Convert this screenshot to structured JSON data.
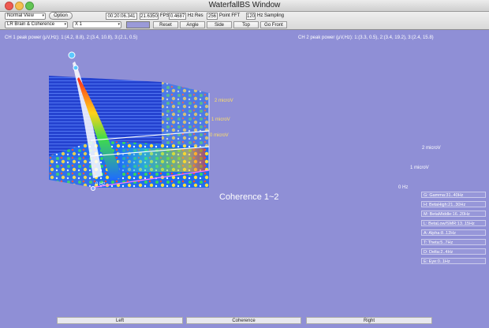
{
  "window": {
    "title": "WaterfallBS Window"
  },
  "toolbar": {
    "view_select": "Normal View",
    "option_button": "Option",
    "mode_select": "LR Brain & Coherence",
    "scale_select": "X 1",
    "time_value": "00:20:06.341",
    "fps_value": "21.6350",
    "fps_label": "FPS",
    "hz_res_value": "0.4687",
    "hz_res_label": "Hz Res",
    "fft_value": "256",
    "fft_label": "Point FFT",
    "sampling_value": "120",
    "sampling_label": "Hz Sampling",
    "reset_button": "Reset",
    "angle_button": "Angle",
    "side_button": "Side",
    "top_button": "Top",
    "go_front_button": "Go Front",
    "swatch_color": "#9a9ad8"
  },
  "left_plot": {
    "title": "CH 1 peak power (μV,Hz): 1:(4.2, 8.8), 2:(3.4, 10.8), 3:(2.1, 0.5)",
    "y_labels": [
      "2 microV",
      "1 microV",
      "0 microV"
    ],
    "axis_label": "0 Hz"
  },
  "right_plot": {
    "title": "CH 2 peak power (μV,Hz): 1:(3.3, 0.5), 2:(3.4, 19.2), 3:(2.4, 15.8)",
    "y_labels": [
      "2 microV",
      "1 microV"
    ],
    "axis_label": "0 Hz"
  },
  "coherence": {
    "label": "Coherence 1~2"
  },
  "band_legend": [
    "G: Gamma:31..40Hz",
    "H: BetaHigh:21..30Hz",
    "M: BetaMiddle:16..20Hz",
    "L: BetaLow/SMR:13..15Hz",
    "A: Alpha:8..12Hz",
    "T: Theta:5..7Hz",
    "D: Delta:2..4Hz",
    "E: Eye:0..1Hz"
  ],
  "bottom_labels": {
    "left": "Left",
    "center": "Coherence",
    "right": "Right"
  },
  "colors": {
    "background": "#8f8fd6",
    "platform": "#1f3fd0",
    "accent_yellow": "#ffe066"
  }
}
